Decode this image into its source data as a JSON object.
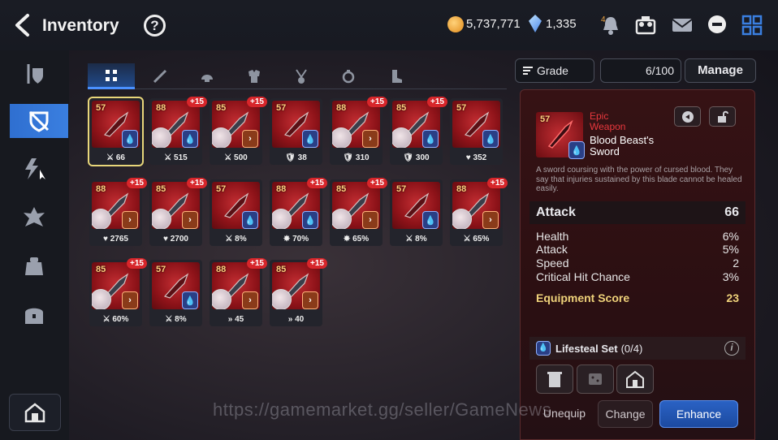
{
  "header": {
    "title": "Inventory",
    "help": "?",
    "gold": "5,737,771",
    "crystals": "1,335",
    "notification_badge": "4"
  },
  "sidebar": {
    "items": [
      "weapon-shield",
      "equipment",
      "artifact",
      "catalyst",
      "materials",
      "chest"
    ],
    "active": "equipment"
  },
  "tabs": [
    "all",
    "weapon",
    "helmet",
    "armor",
    "necklace",
    "ring",
    "boots"
  ],
  "items": [
    {
      "level": "57",
      "plus": "",
      "stat_icon": "attack",
      "stat": "66",
      "set": "blue",
      "portrait": false,
      "selected": true
    },
    {
      "level": "88",
      "plus": "+15",
      "stat_icon": "attack",
      "stat": "515",
      "set": "blue",
      "portrait": true
    },
    {
      "level": "85",
      "plus": "+15",
      "stat_icon": "attack",
      "stat": "500",
      "set": "orange",
      "portrait": true
    },
    {
      "level": "57",
      "plus": "",
      "stat_icon": "defense",
      "stat": "38",
      "set": "blue",
      "portrait": false
    },
    {
      "level": "88",
      "plus": "+15",
      "stat_icon": "defense",
      "stat": "310",
      "set": "orange",
      "portrait": true
    },
    {
      "level": "85",
      "plus": "+15",
      "stat_icon": "defense",
      "stat": "300",
      "set": "blue",
      "portrait": true
    },
    {
      "level": "57",
      "plus": "",
      "stat_icon": "health",
      "stat": "352",
      "set": "blue",
      "portrait": false
    },
    {
      "level": "88",
      "plus": "+15",
      "stat_icon": "health",
      "stat": "2765",
      "set": "orange",
      "portrait": true
    },
    {
      "level": "85",
      "plus": "+15",
      "stat_icon": "health",
      "stat": "2700",
      "set": "orange",
      "portrait": true
    },
    {
      "level": "57",
      "plus": "",
      "stat_icon": "attack",
      "stat": "8%",
      "set": "blue",
      "portrait": false
    },
    {
      "level": "88",
      "plus": "+15",
      "stat_icon": "crit",
      "stat": "70%",
      "set": "blue",
      "portrait": true
    },
    {
      "level": "85",
      "plus": "+15",
      "stat_icon": "crit",
      "stat": "65%",
      "set": "orange",
      "portrait": true
    },
    {
      "level": "57",
      "plus": "",
      "stat_icon": "attack",
      "stat": "8%",
      "set": "blue",
      "portrait": false
    },
    {
      "level": "88",
      "plus": "+15",
      "stat_icon": "attack",
      "stat": "65%",
      "set": "orange",
      "portrait": true
    },
    {
      "level": "85",
      "plus": "+15",
      "stat_icon": "attack",
      "stat": "60%",
      "set": "orange",
      "portrait": true
    },
    {
      "level": "57",
      "plus": "",
      "stat_icon": "attack",
      "stat": "8%",
      "set": "blue",
      "portrait": false
    },
    {
      "level": "88",
      "plus": "+15",
      "stat_icon": "speed",
      "stat": "45",
      "set": "orange",
      "portrait": true
    },
    {
      "level": "85",
      "plus": "+15",
      "stat_icon": "speed",
      "stat": "40",
      "set": "orange",
      "portrait": true
    }
  ],
  "controls": {
    "filter_label": "Grade",
    "count": "6/100",
    "manage_label": "Manage"
  },
  "detail": {
    "level": "57",
    "rarity": "Epic",
    "type": "Weapon",
    "name": "Blood Beast's Sword",
    "description": "A sword coursing with the power of cursed blood. They say that injuries sustained by this blade cannot be healed easily.",
    "main_stat_name": "Attack",
    "main_stat_value": "66",
    "substats": [
      {
        "name": "Health",
        "value": "6%"
      },
      {
        "name": "Attack",
        "value": "5%"
      },
      {
        "name": "Speed",
        "value": "2"
      },
      {
        "name": "Critical Hit Chance",
        "value": "3%"
      }
    ],
    "score_label": "Equipment Score",
    "score_value": "23",
    "set_name": "Lifesteal Set",
    "set_progress": "(0/4)",
    "unequip_label": "Unequip",
    "change_label": "Change",
    "enhance_label": "Enhance"
  },
  "watermark": "https://gamemarket.gg/seller/GameNews",
  "colors": {
    "accent_blue": "#2f6fd0",
    "rarity_epic": "#e8383d",
    "score_gold": "#efd27a",
    "plus_badge": "#d7262b"
  }
}
